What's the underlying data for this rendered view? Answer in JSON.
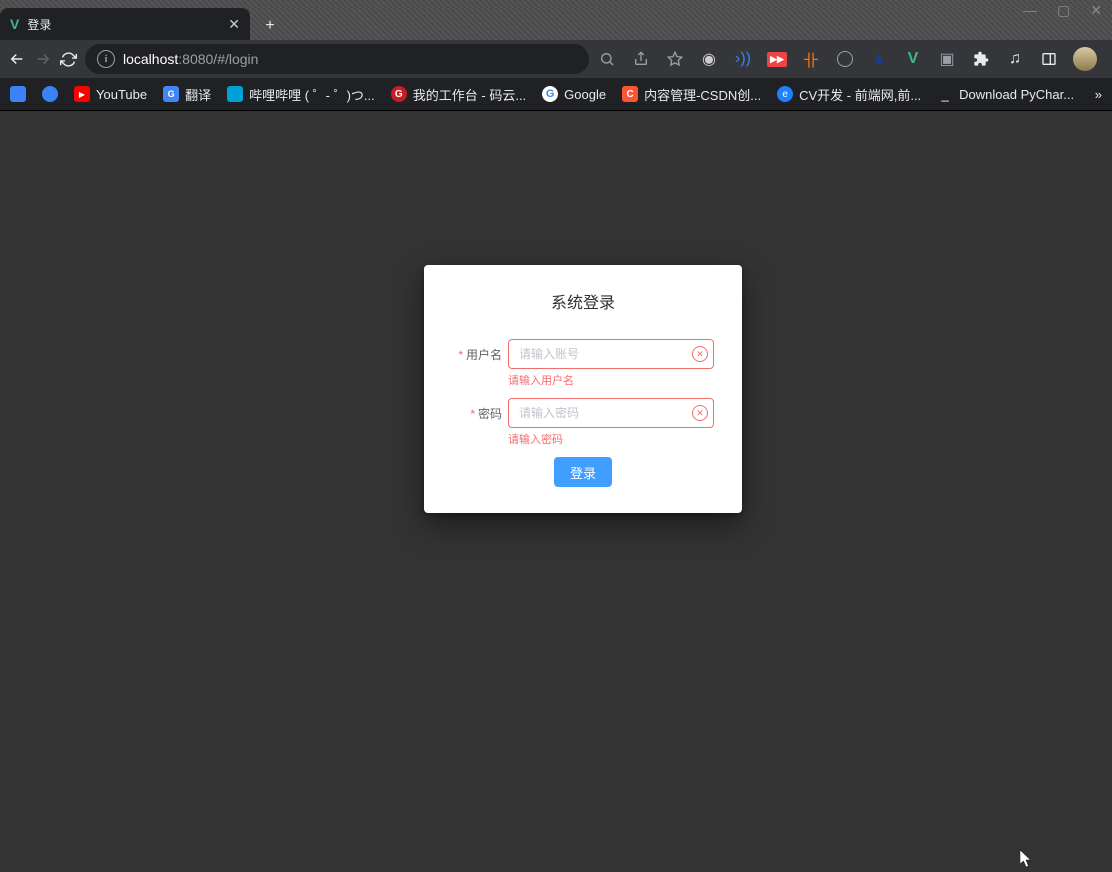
{
  "window": {
    "tab_title": "登录",
    "new_tab_tooltip": "+"
  },
  "toolbar": {
    "url_host": "localhost",
    "url_port_path": ":8080/#/login"
  },
  "bookmarks": [
    {
      "label": "",
      "color": "#3b82f6"
    },
    {
      "label": "",
      "color": "#3b82f6"
    },
    {
      "label": "YouTube",
      "color": "#ff0000"
    },
    {
      "label": "翻译",
      "color": "#4285F4"
    },
    {
      "label": "哔哩哔哩 (  ゜- ゜)つ...",
      "color": "#00A1D6"
    },
    {
      "label": "我的工作台 - 码云...",
      "color": "#C71D23"
    },
    {
      "label": "Google",
      "color": "#ffffff"
    },
    {
      "label": "内容管理-CSDN创...",
      "color": "#FC5531"
    },
    {
      "label": "CV开发 - 前端网,前...",
      "color": "#1E80FF"
    },
    {
      "label": "Download PyChar...",
      "color": ""
    }
  ],
  "login": {
    "title": "系统登录",
    "username_label": "用户名",
    "username_placeholder": "请输入账号",
    "username_error": "请输入用户名",
    "password_label": "密码",
    "password_placeholder": "请输入密码",
    "password_error": "请输入密码",
    "submit": "登录"
  }
}
